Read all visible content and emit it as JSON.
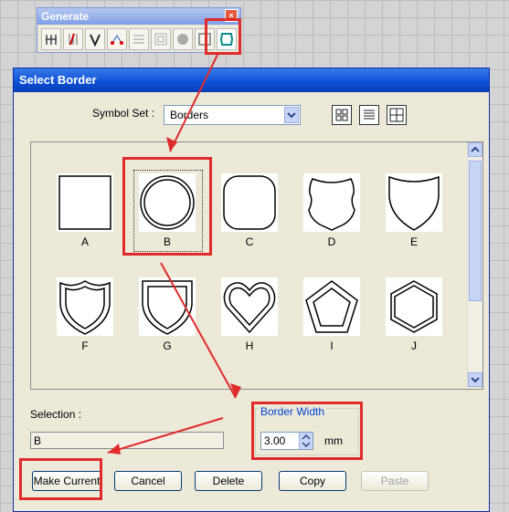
{
  "generate_toolbar": {
    "title": "Generate",
    "close_glyph": "×",
    "tools": [
      {
        "icon": "align-text-icon"
      },
      {
        "icon": "grid-pen-icon"
      },
      {
        "icon": "monogram-v-icon"
      },
      {
        "icon": "node-plus-icon"
      },
      {
        "icon": "grid-lines-icon"
      },
      {
        "icon": "layers-icon"
      },
      {
        "icon": "circle-fill-icon"
      },
      {
        "icon": "frame-icon"
      },
      {
        "icon": "select-border-icon"
      }
    ]
  },
  "dialog": {
    "title": "Select Border",
    "symbol_set_label": "Symbol Set :",
    "symbol_set_value": "Borders",
    "view_modes": [
      "large-icons-view",
      "list-view",
      "small-icons-view"
    ],
    "symbols": [
      {
        "name": "A",
        "shape": "square"
      },
      {
        "name": "B",
        "shape": "circle",
        "selected": true
      },
      {
        "name": "C",
        "shape": "rounded-square"
      },
      {
        "name": "D",
        "shape": "badge"
      },
      {
        "name": "E",
        "shape": "shield"
      },
      {
        "name": "F",
        "shape": "shield-scalloped"
      },
      {
        "name": "G",
        "shape": "shield-flat"
      },
      {
        "name": "H",
        "shape": "heart"
      },
      {
        "name": "I",
        "shape": "pentagon"
      },
      {
        "name": "J",
        "shape": "hexagon"
      }
    ],
    "selection_label": "Selection :",
    "selection_value": "B",
    "border_width_label": "Border Width",
    "border_width_value": "3.00",
    "border_width_unit": "mm",
    "buttons": {
      "make_current": "Make Current",
      "cancel": "Cancel",
      "delete": "Delete",
      "copy": "Copy",
      "paste": "Paste"
    }
  },
  "colors": {
    "highlight": "#e02b2b",
    "title_bar": "#0a4ed6",
    "dialog_bg": "#ece9d8"
  }
}
